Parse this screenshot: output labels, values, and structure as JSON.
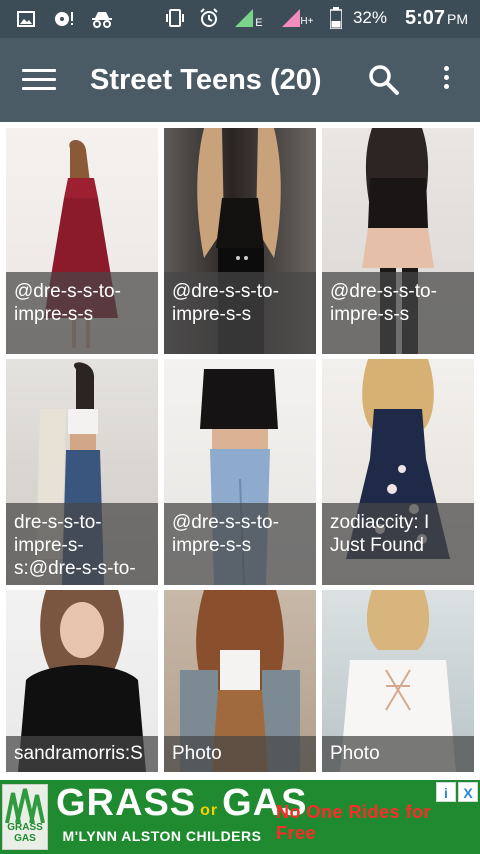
{
  "status_bar": {
    "battery_percent": "32%",
    "time": "5:07",
    "ampm": "PM",
    "network_label": "E",
    "signal_label": "H+"
  },
  "app_bar": {
    "title": "Street Teens (20)"
  },
  "grid": {
    "tiles": [
      {
        "caption": "@dre-s-s-to-impre-s-s"
      },
      {
        "caption": "@dre-s-s-to-impre-s-s"
      },
      {
        "caption": "@dre-s-s-to-impre-s-s"
      },
      {
        "caption": "dre-s-s-to-impre-s-s:@dre-s-s-to-"
      },
      {
        "caption": "@dre-s-s-to-impre-s-s"
      },
      {
        "caption": "zodiaccity: I Just Found"
      },
      {
        "caption": "sandramorris:S"
      },
      {
        "caption": "Photo"
      },
      {
        "caption": "Photo"
      }
    ]
  },
  "ad": {
    "logo_text": "GRASS GAS",
    "headline": "GRASS",
    "headline_or": "or",
    "headline2": "GAS",
    "subline": "M'LYNN ALSTON CHILDERS",
    "tagline": "No One Rides for Free",
    "info_icon": "i",
    "close_icon": "X"
  },
  "colors": {
    "status_bar": "#3d4d57",
    "app_bar": "#4a5b66",
    "caption_overlay": "rgba(70,70,70,0.72)",
    "ad_green": "#1f8a2f",
    "ad_red": "#ff2b2b"
  }
}
